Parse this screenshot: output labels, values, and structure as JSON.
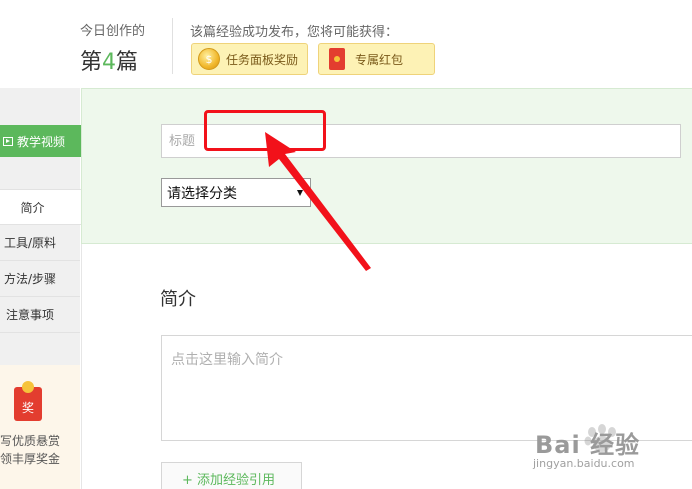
{
  "header": {
    "today_label": "今日创作的",
    "today_count_prefix": "第",
    "today_count_number": "4",
    "today_count_suffix": "篇",
    "reward_title": "该篇经验成功发布，您将可能获得：",
    "rewards": [
      {
        "label": "任务面板奖励",
        "icon": "coin-icon",
        "coin_glyph": "$"
      },
      {
        "label": "专属红包",
        "icon": "red-envelope-icon"
      }
    ]
  },
  "sidebar": {
    "video_button": "教学视频",
    "nav": [
      {
        "label": "简介",
        "active": true
      },
      {
        "label": "工具/原料",
        "active": false
      },
      {
        "label": "方法/步骤",
        "active": false
      },
      {
        "label": "注意事项",
        "active": false
      }
    ],
    "promo": {
      "prize_glyph": "奖",
      "line1": "写优质悬赏",
      "line2": "领丰厚奖金"
    }
  },
  "form": {
    "title_placeholder": "标题",
    "category_value": "请选择分类",
    "section_title": "简介",
    "intro_placeholder": "点击这里输入简介",
    "add_reference": "+ 添加经验引用"
  },
  "watermark": {
    "brand": "Bai 经验",
    "url": "jingyan.baidu.com"
  },
  "colors": {
    "accent_green": "#5cb85c",
    "annotation_red": "#f2111a",
    "form_bg": "#eef8ec",
    "reward_bg": "#fdf2b5"
  }
}
